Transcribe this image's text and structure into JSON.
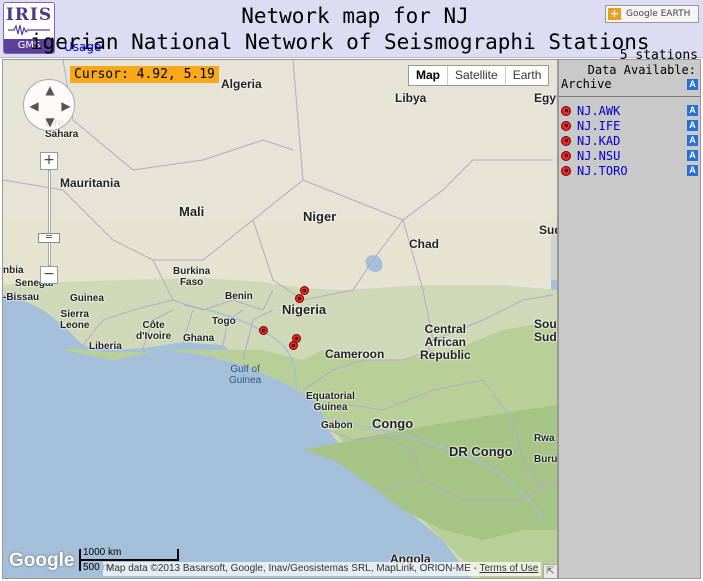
{
  "header": {
    "logo_text": "IRIS",
    "logo_sub": "GMS",
    "title": "Network map for NJ",
    "subtitle": "igerian National Network of Seismographi Stations",
    "usage_link": "Usage",
    "google_earth_button": {
      "plus": "+",
      "google": "Google",
      "earth": "EARTH"
    }
  },
  "map": {
    "cursor_readout": "Cursor: 4.92, 5.19",
    "map_types": [
      "Map",
      "Satellite",
      "Earth"
    ],
    "active_map_type": "Map",
    "zoom_in": "+",
    "zoom_out": "−",
    "labels": {
      "algeria": "Algeria",
      "libya": "Libya",
      "egypt": "Egyp",
      "western_sahara": "tern\nSahara",
      "mauritania": "Mauritania",
      "mali": "Mali",
      "niger": "Niger",
      "chad": "Chad",
      "sudan": "Sud",
      "senegal": "Senegal",
      "gambia": "nbia",
      "guinea_bissau": "-Bissau",
      "guinea": "Guinea",
      "burkina_faso": "Burkina\nFaso",
      "benin": "Benin",
      "nigeria": "Nigeria",
      "sierra_leone": "Sierra\nLeone",
      "cote_divoire": "Côte\nd'Ivoire",
      "ghana": "Ghana",
      "togo": "Togo",
      "liberia": "Liberia",
      "cameroon": "Cameroon",
      "car": "Central\nAfrican\nRepublic",
      "south_sudan": "Sou\nSuda",
      "gulf_of_guinea": "Gulf of\nGuinea",
      "equatorial_guinea": "Equatorial\nGuinea",
      "gabon": "Gabon",
      "congo": "Congo",
      "dr_congo": "DR Congo",
      "rwanda": "Rwa",
      "burundi": "Buru",
      "angola": "Angola"
    },
    "google_logo": "Google",
    "scale": {
      "km": "1000 km",
      "mi": "500 mi"
    },
    "attribution": "Map data ©2013 Basarsoft, Google, Inav/Geosistemas SRL, MapLink, ORION-ME - ",
    "terms": "Terms of Use"
  },
  "panel": {
    "station_count": "5 stations",
    "data_available": "Data Available:",
    "archive_label": "Archive",
    "archive_badge": "A",
    "stations": [
      {
        "code": "NJ.AWK",
        "badge": "A"
      },
      {
        "code": "NJ.IFE",
        "badge": "A"
      },
      {
        "code": "NJ.KAD",
        "badge": "A"
      },
      {
        "code": "NJ.NSU",
        "badge": "A"
      },
      {
        "code": "NJ.TORO",
        "badge": "A"
      }
    ]
  },
  "colors": {
    "header_bg": "#dcdcf2",
    "marker_red": "#e82828",
    "cursor_bg": "#f8a818",
    "link_blue": "#0000cc",
    "archive_badge": "#2a6fd6",
    "panel_bg": "#c9c9c9",
    "ocean": "#a4bfd9"
  }
}
